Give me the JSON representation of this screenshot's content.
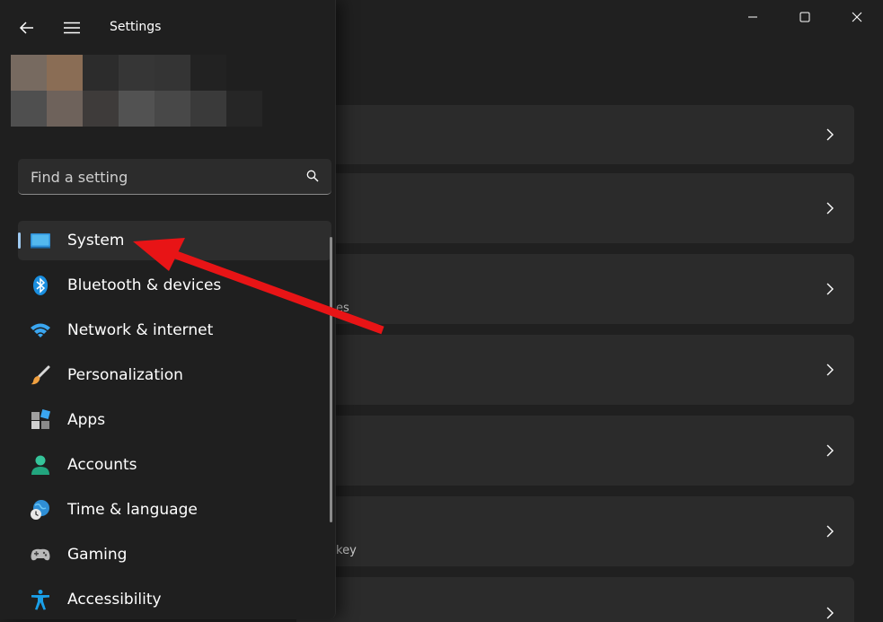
{
  "window": {
    "title": "Settings",
    "controls": [
      "minimize-icon",
      "maximize-icon",
      "close-icon"
    ]
  },
  "search": {
    "placeholder": "Find a setting",
    "icon": "search-icon"
  },
  "sidebar": {
    "items": [
      {
        "label": "System",
        "icon": "system-monitor-icon",
        "selected": true
      },
      {
        "label": "Bluetooth & devices",
        "icon": "bluetooth-icon"
      },
      {
        "label": "Network & internet",
        "icon": "wifi-icon"
      },
      {
        "label": "Personalization",
        "icon": "paintbrush-icon"
      },
      {
        "label": "Apps",
        "icon": "apps-icon"
      },
      {
        "label": "Accounts",
        "icon": "person-icon"
      },
      {
        "label": "Time & language",
        "icon": "globe-clock-icon"
      },
      {
        "label": "Gaming",
        "icon": "gamepad-icon"
      },
      {
        "label": "Accessibility",
        "icon": "accessibility-icon"
      }
    ]
  },
  "main": {
    "card_partials": [
      "",
      "",
      "es",
      "",
      "",
      "key",
      ""
    ]
  },
  "annotation": {
    "type": "arrow",
    "color": "#e81416",
    "points_to": "System"
  }
}
